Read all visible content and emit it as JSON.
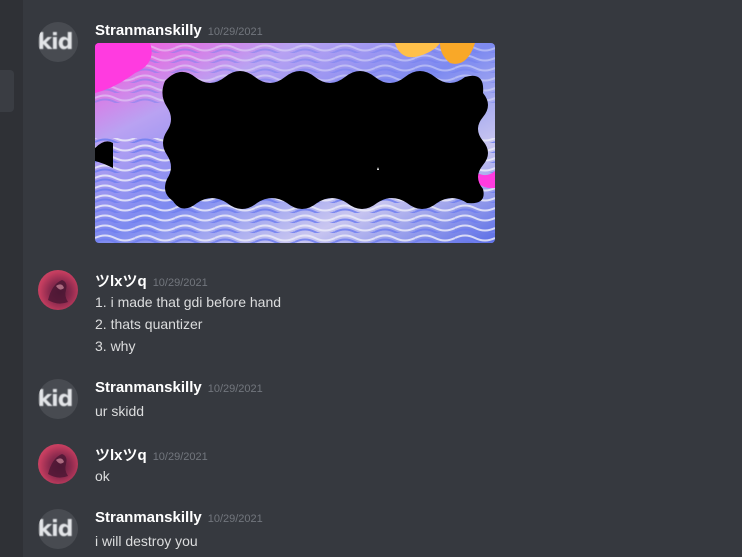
{
  "messages": [
    {
      "author": "Stranmanskilly",
      "timestamp": "10/29/2021",
      "avatar_icon": "skid-avatar-icon",
      "avatar_text": "kid",
      "lines": [],
      "attachment": "image"
    },
    {
      "author": "ツlxツq",
      "timestamp": "10/29/2021",
      "avatar_icon": "photo-avatar-icon",
      "lines": [
        "1. i made that gdi before hand",
        "2. thats quantizer",
        "3. why"
      ]
    },
    {
      "author": "Stranmanskilly",
      "timestamp": "10/29/2021",
      "avatar_icon": "skid-avatar-icon",
      "avatar_text": "kid",
      "lines": [
        "ur skidd"
      ]
    },
    {
      "author": "ツlxツq",
      "timestamp": "10/29/2021",
      "avatar_icon": "photo-avatar-icon",
      "lines": [
        "ok"
      ]
    },
    {
      "author": "Stranmanskilly",
      "timestamp": "10/29/2021",
      "avatar_icon": "skid-avatar-icon",
      "avatar_text": "kid",
      "lines": [
        "i will destroy you"
      ]
    }
  ],
  "colors": {
    "background": "#36393f",
    "username": "#ffffff",
    "timestamp": "#72767d",
    "message_text": "#dcddde"
  }
}
